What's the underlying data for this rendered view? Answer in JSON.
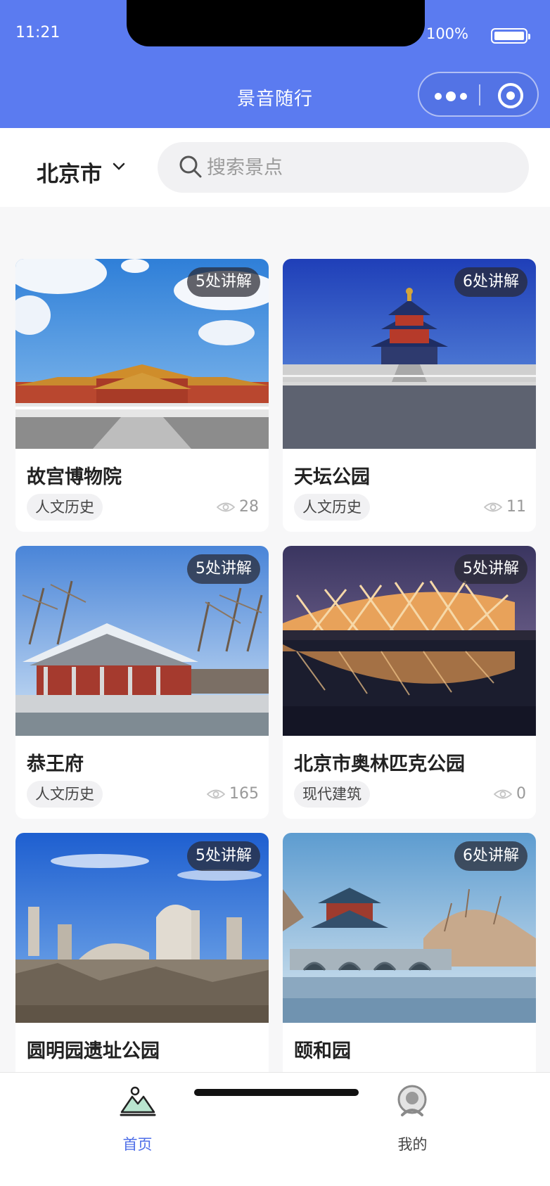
{
  "status": {
    "time": "11:21",
    "battery": "100%"
  },
  "nav": {
    "title": "景音随行"
  },
  "search": {
    "city": "北京市",
    "placeholder": "搜索景点"
  },
  "cards": [
    {
      "title": "故宫博物院",
      "badge": "5处讲解",
      "tag": "人文历史",
      "views": "28"
    },
    {
      "title": "天坛公园",
      "badge": "6处讲解",
      "tag": "人文历史",
      "views": "11"
    },
    {
      "title": "恭王府",
      "badge": "5处讲解",
      "tag": "人文历史",
      "views": "165"
    },
    {
      "title": "北京市奥林匹克公园",
      "badge": "5处讲解",
      "tag": "现代建筑",
      "views": "0"
    },
    {
      "title": "圆明园遗址公园",
      "badge": "5处讲解",
      "tag": "",
      "views": ""
    },
    {
      "title": "颐和园",
      "badge": "6处讲解",
      "tag": "",
      "views": ""
    }
  ],
  "tabbar": {
    "home": "首页",
    "mine": "我的"
  },
  "colors": {
    "primary": "#5b7bf0",
    "active_tab": "#4f6fe8"
  }
}
